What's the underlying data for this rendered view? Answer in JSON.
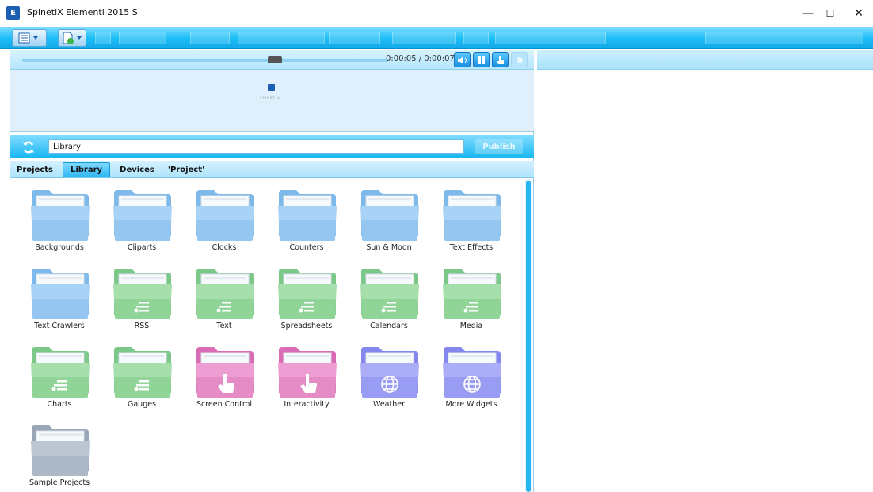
{
  "window": {
    "title": "SpinetiX Elementi 2015 S",
    "logo": "E",
    "controls": {
      "minimize": "—",
      "maximize": "☐",
      "close": "✕"
    }
  },
  "player": {
    "time": "0:00:05 / 0:00:07",
    "progress": 0.71,
    "buttons": [
      "speaker-icon",
      "pause-icon",
      "hand-pointer-icon",
      "record-icon"
    ]
  },
  "preview": {
    "brand_text": "SPINETIX"
  },
  "address": {
    "value": "Library",
    "publish_label": "Publish"
  },
  "tabs": [
    {
      "label": "Projects",
      "active": false
    },
    {
      "label": "Library",
      "active": true
    },
    {
      "label": "Devices",
      "active": false
    },
    {
      "label": "'Project'",
      "active": false
    }
  ],
  "library_items": [
    {
      "label": "Backgrounds",
      "color": "blue",
      "icon": "folder-icon"
    },
    {
      "label": "Cliparts",
      "color": "blue",
      "icon": "folder-icon"
    },
    {
      "label": "Clocks",
      "color": "blue",
      "icon": "folder-icon"
    },
    {
      "label": "Counters",
      "color": "blue",
      "icon": "folder-icon"
    },
    {
      "label": "Sun & Moon",
      "color": "blue",
      "icon": "folder-icon"
    },
    {
      "label": "Text Effects",
      "color": "blue",
      "icon": "folder-icon"
    },
    {
      "label": "Text Crawlers",
      "color": "blue",
      "icon": "folder-icon"
    },
    {
      "label": "RSS",
      "color": "green",
      "icon": "data-list-icon"
    },
    {
      "label": "Text",
      "color": "green",
      "icon": "data-list-icon"
    },
    {
      "label": "Spreadsheets",
      "color": "green",
      "icon": "data-list-icon"
    },
    {
      "label": "Calendars",
      "color": "green",
      "icon": "data-list-icon"
    },
    {
      "label": "Media",
      "color": "green",
      "icon": "data-list-icon"
    },
    {
      "label": "Charts",
      "color": "green",
      "icon": "data-list-icon"
    },
    {
      "label": "Gauges",
      "color": "green",
      "icon": "data-list-icon"
    },
    {
      "label": "Screen Control",
      "color": "pink",
      "icon": "hand-pointer-icon"
    },
    {
      "label": "Interactivity",
      "color": "pink",
      "icon": "hand-pointer-icon"
    },
    {
      "label": "Weather",
      "color": "purple",
      "icon": "globe-icon"
    },
    {
      "label": "More Widgets",
      "color": "purple",
      "icon": "globe-icon"
    },
    {
      "label": "Sample Projects",
      "color": "gray",
      "icon": "folder-icon"
    }
  ],
  "colors": {
    "accent": "#1ec0f7",
    "blue_folder": "#7db9ea",
    "green_folder": "#86d28f",
    "pink_folder": "#e27bc0",
    "purple_folder": "#8e8ff0",
    "gray_folder": "#a8b4c4"
  }
}
